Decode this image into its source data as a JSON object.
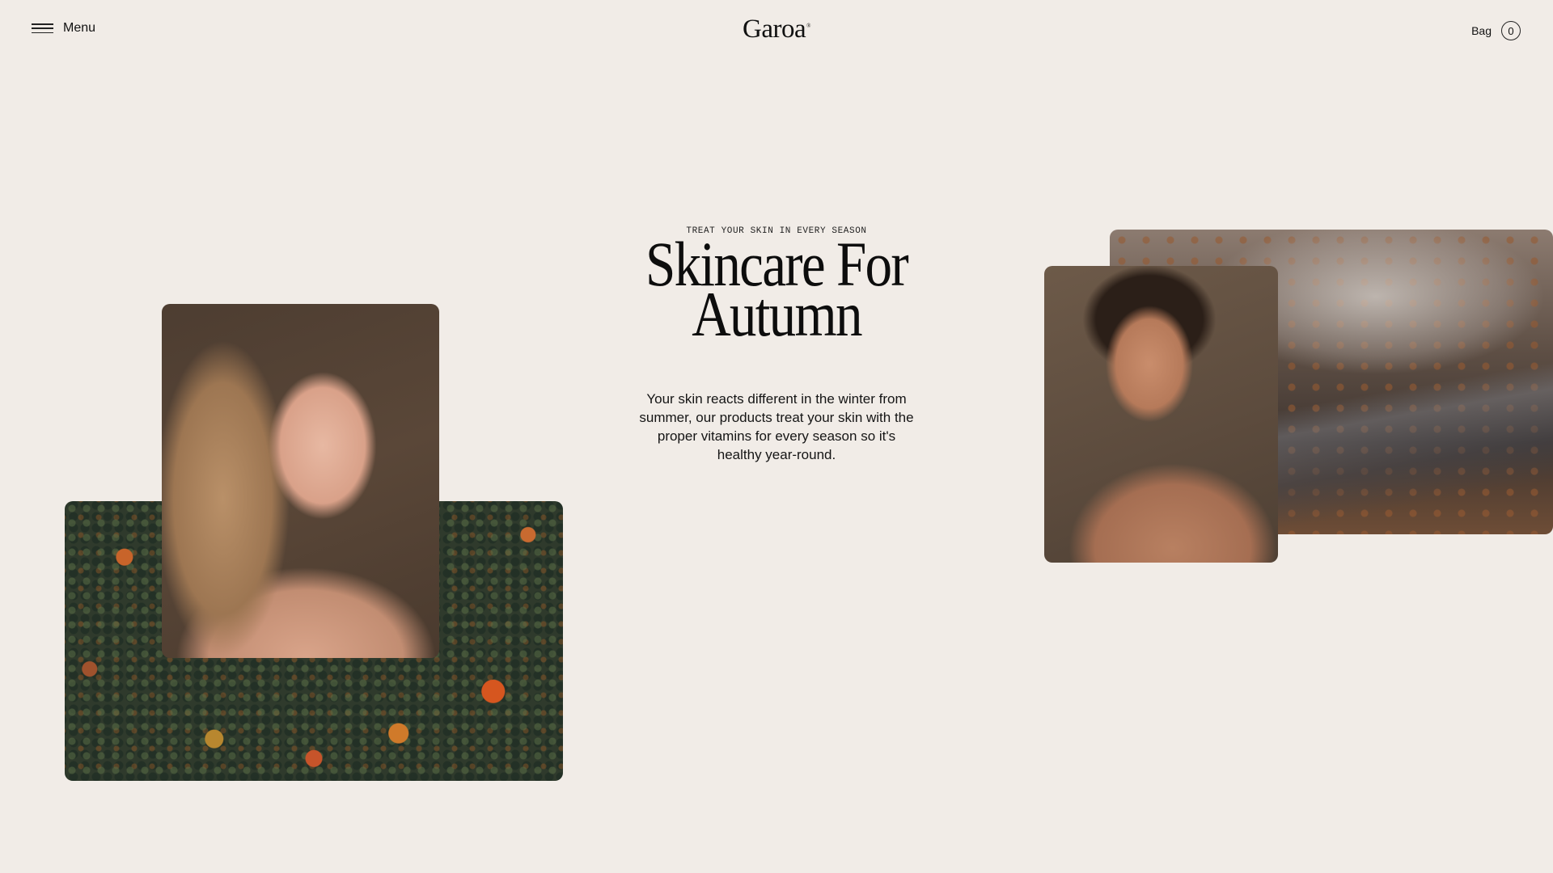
{
  "header": {
    "menu_label": "Menu",
    "logo": "Garoa",
    "logo_mark": "®",
    "bag_label": "Bag",
    "bag_count": "0"
  },
  "hero": {
    "eyebrow": "TREAT YOUR SKIN IN EVERY SEASON",
    "headline_line1": "Skincare For",
    "headline_line2": "Autumn",
    "body": "Your skin reacts different in the winter from summer, our products treat your skin with the proper vitamins for every season so it's healthy year-round."
  },
  "colors": {
    "background": "#f1ece7",
    "text": "#111111"
  },
  "icons": {
    "menu": "hamburger-icon",
    "bag_count": "circle-badge"
  }
}
